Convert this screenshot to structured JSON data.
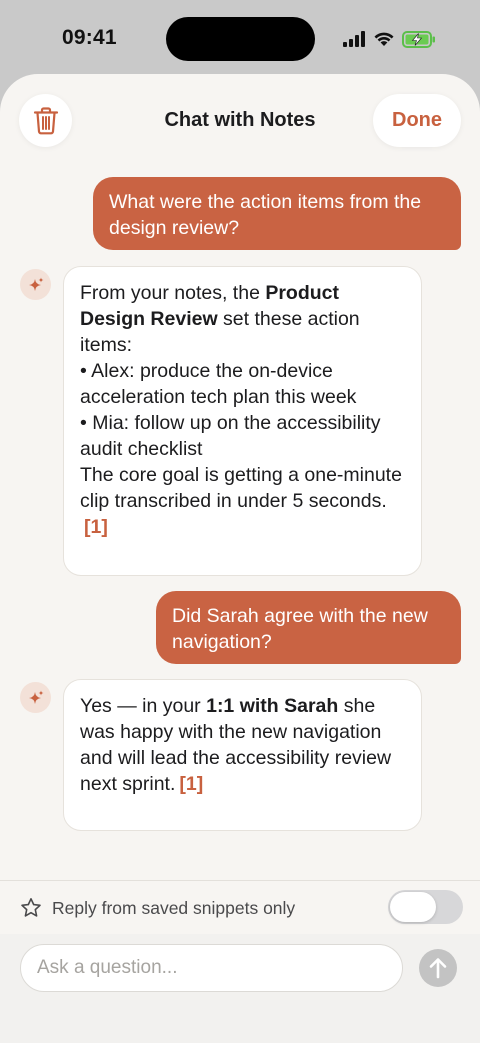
{
  "status_bar": {
    "time": "09:41"
  },
  "nav": {
    "title": "Chat with Notes",
    "done_label": "Done"
  },
  "messages": {
    "user1": "What were the action items from the design review?",
    "ai1": {
      "intro": "From your notes, the ",
      "bold": "Product Design Review",
      "intro_end": " set these action items:",
      "bullet1": "•  Alex: produce the on-device acceleration tech plan this week",
      "bullet2": "•  Mia: follow up on the accessibility audit checklist",
      "outro": "The core goal is getting a one-minute clip transcribed in under 5 seconds.",
      "citation": "[1]"
    },
    "user2": "Did Sarah agree with the new navigation?",
    "ai2": {
      "intro": "Yes — in your ",
      "bold": "1:1 with Sarah",
      "rest": " she was happy with the new navigation and will lead the accessibility review next sprint.",
      "citation": "[1]"
    }
  },
  "snippets": {
    "label": "Reply from saved snippets only",
    "enabled": false
  },
  "composer": {
    "placeholder": "Ask a question..."
  },
  "colors": {
    "accent": "#c96343",
    "sheet_bg": "#f7f5f2"
  }
}
